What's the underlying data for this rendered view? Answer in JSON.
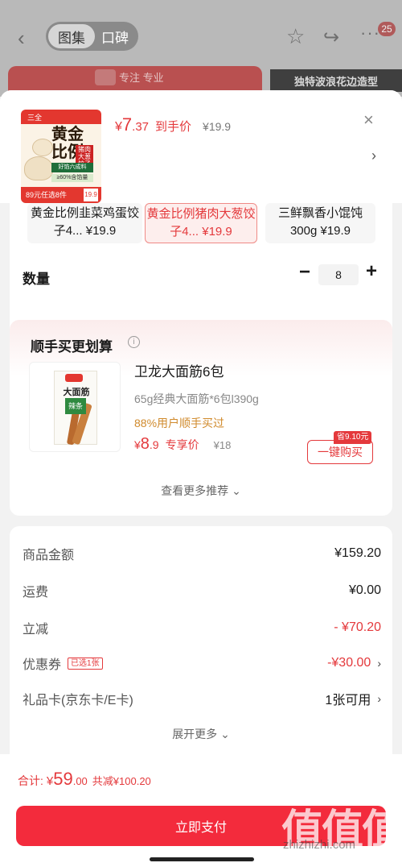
{
  "topbar": {
    "back_icon": "chevron-left-icon",
    "tabs": [
      "图集",
      "口碑"
    ],
    "badge": "25",
    "banner_left": "专注 专业",
    "banner_right": "独特波浪花边造型"
  },
  "product": {
    "image_title": "黄金比例",
    "image_tag": "猪肉大葱饺子",
    "image_green": "好馅六成料",
    "image_green2": "≥60%含馅量",
    "image_bottom": "89元任选8件",
    "image_price": "19.9",
    "price_symbol": "¥",
    "price_int": "7",
    "price_dec": ".37",
    "price_tag": "到手价",
    "original_price": "¥19.9"
  },
  "variants": [
    {
      "label": "黄金比例韭菜鸡蛋饺子4...  ¥19.9",
      "selected": false
    },
    {
      "label": "黄金比例猪肉大葱饺子4...  ¥19.9",
      "selected": true
    },
    {
      "label": "三鲜飘香小馄饨300g  ¥19.9",
      "selected": false
    }
  ],
  "quantity": {
    "label": "数量",
    "value": "8"
  },
  "upsell": {
    "title": "顺手买更划算",
    "image_title": "大面筋",
    "image_green": "辣条",
    "name": "卫龙大面筋6包",
    "spec": "65g经典大面筋*6包l390g",
    "buyers": "88%用户顺手买过",
    "price_symbol": "¥",
    "price_int": "8",
    "price_dec": ".9",
    "price_tag": "专享价",
    "original_price": "¥18",
    "save_badge": "省9.10元",
    "buy_label": "一键购买",
    "see_more": "查看更多推荐"
  },
  "summary": {
    "rows": [
      {
        "label": "商品金额",
        "value": "¥159.20"
      },
      {
        "label": "运费",
        "value": "¥0.00"
      },
      {
        "label": "立减",
        "value": "- ¥70.20"
      },
      {
        "label": "优惠券",
        "tag": "已选1张",
        "value": "-¥30.00"
      },
      {
        "label": "礼品卡(京东卡/E卡)",
        "value": "1张可用"
      }
    ],
    "expand": "展开更多"
  },
  "bottom": {
    "total_label": "合计:",
    "total_symbol": "¥",
    "total_int": "59",
    "total_dec": ".00",
    "saved": "共减¥100.20",
    "pay_label": "立即支付"
  },
  "watermark": {
    "text": "值值值",
    "url": "zhizhizhi.com"
  },
  "colors": {
    "accent": "#e4393c",
    "pay_button": "#f32b3c"
  }
}
